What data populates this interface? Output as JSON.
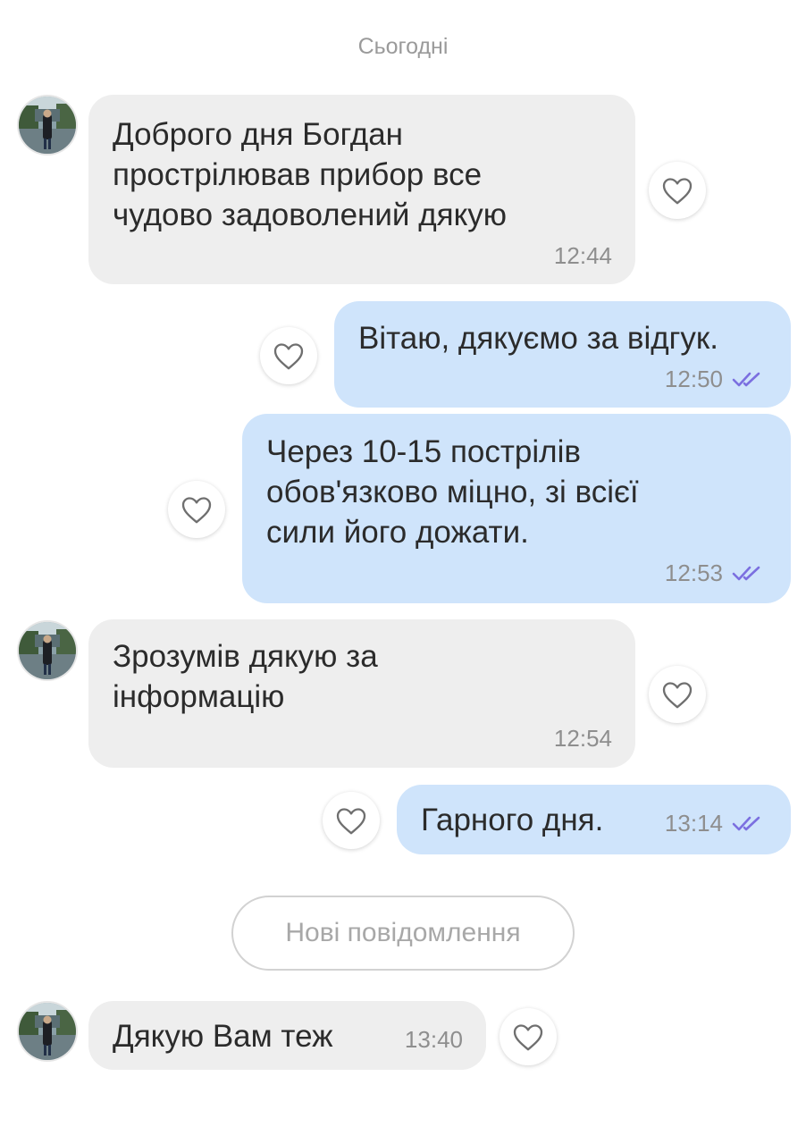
{
  "chat": {
    "date_separator": "Сьогодні",
    "new_messages_label": "Нові повідомлення",
    "messages": [
      {
        "direction": "incoming",
        "text": "Доброго дня Богдан\nпрострілював прибор все\nчудово задоволений дякую",
        "time": "12:44"
      },
      {
        "direction": "outgoing",
        "text": "Вітаю, дякуємо за відгук.",
        "time": "12:50",
        "status": "read"
      },
      {
        "direction": "outgoing",
        "text": "Через 10-15 пострілів\nобов'язково міцно, зі всієї\nсили його дожати.",
        "time": "12:53",
        "status": "read"
      },
      {
        "direction": "incoming",
        "text": "Зрозумів дякую за\nінформацію",
        "time": "12:54"
      },
      {
        "direction": "outgoing",
        "text": "Гарного дня.",
        "time": "13:14",
        "status": "read"
      },
      {
        "direction": "incoming",
        "text": "Дякую Вам теж",
        "time": "13:40"
      }
    ]
  },
  "colors": {
    "incoming_bubble": "#eeeeee",
    "outgoing_bubble": "#cfe4fb",
    "read_check": "#7b6fe0",
    "secondary_text": "#8e8e8e"
  },
  "icons": {
    "like": "heart-outline-icon",
    "read_status": "double-check-icon"
  }
}
